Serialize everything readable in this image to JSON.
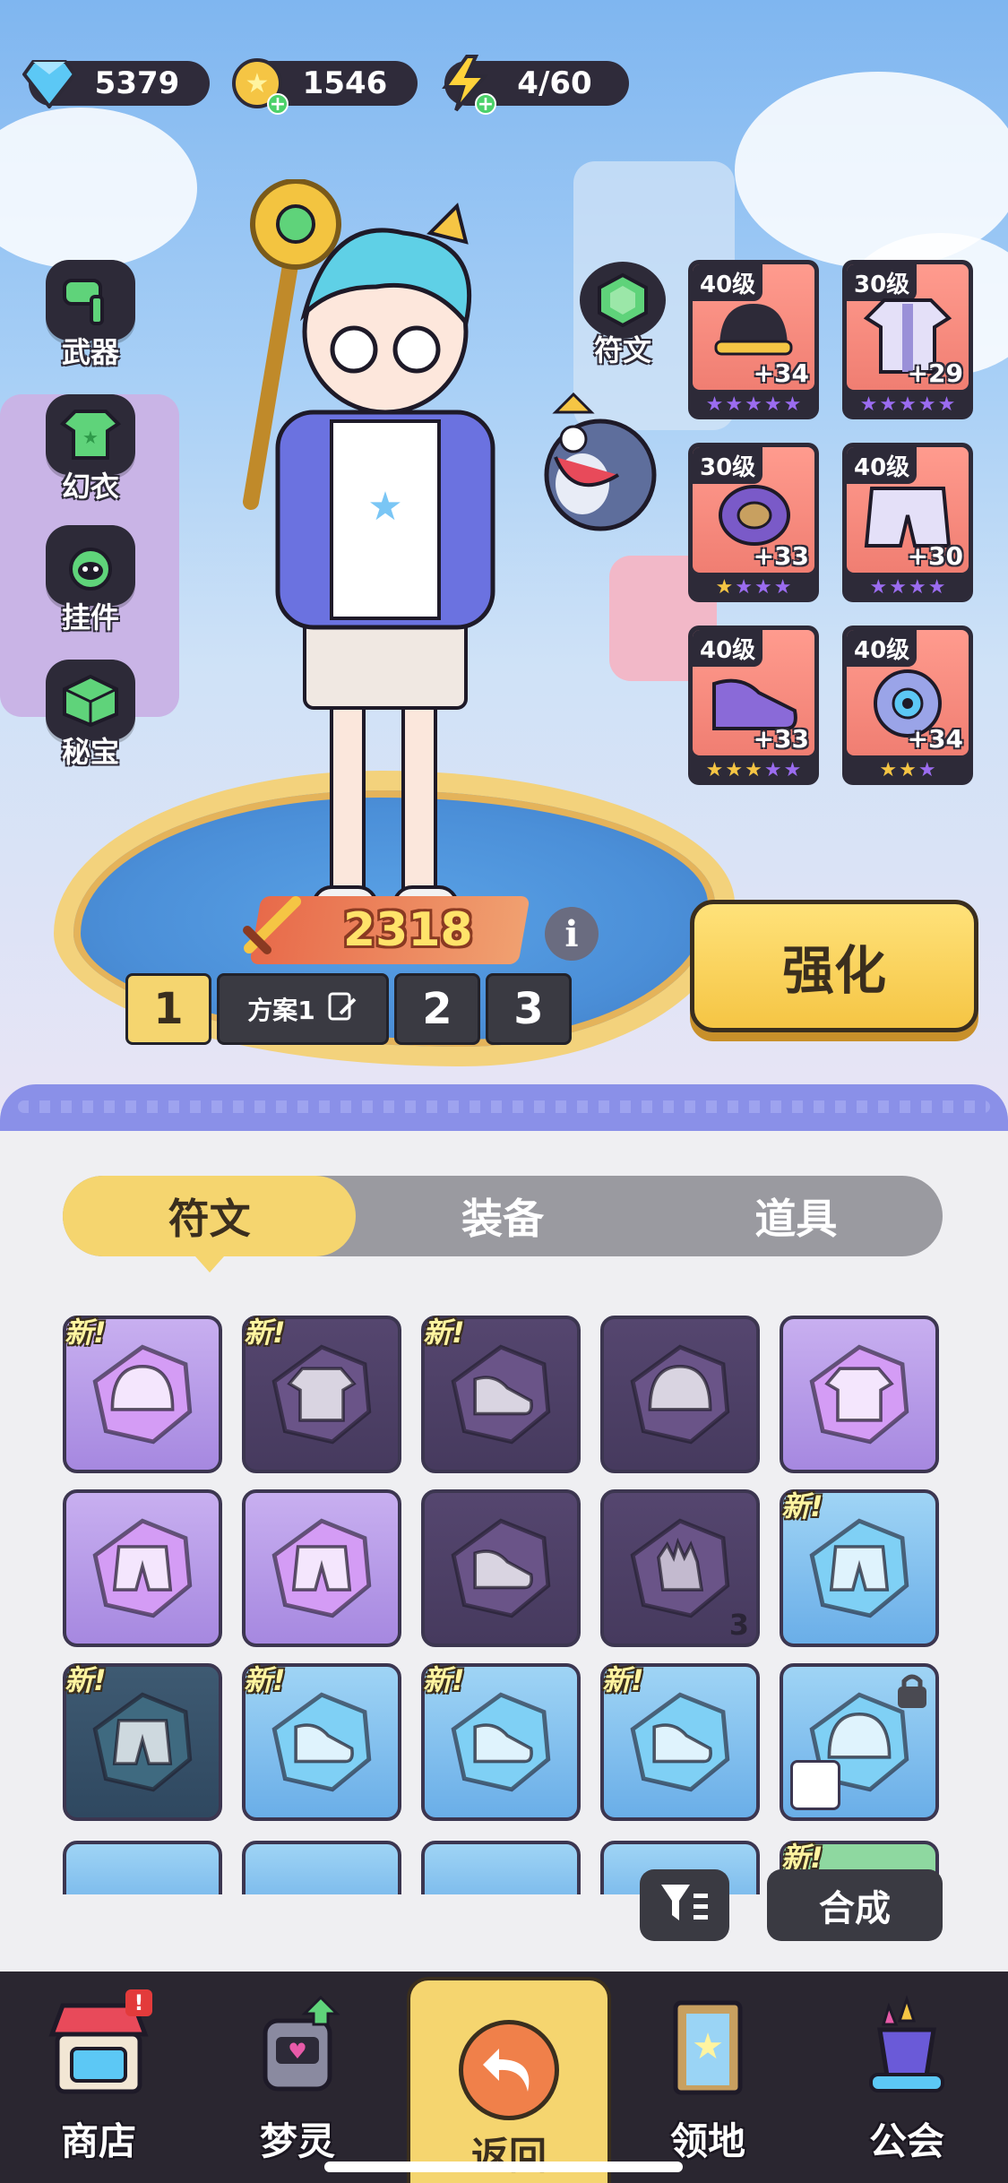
{
  "resources": [
    {
      "id": "gems",
      "icon": "diamond-icon",
      "value": "5379",
      "has_plus": false
    },
    {
      "id": "coins",
      "icon": "coin-icon",
      "value": "1546",
      "has_plus": true
    },
    {
      "id": "energy",
      "icon": "lightning-icon",
      "value": "4/60",
      "has_plus": true
    }
  ],
  "side_menu": [
    {
      "id": "weapon",
      "label": "武器",
      "icon": "hammer-icon"
    },
    {
      "id": "outfit",
      "label": "幻衣",
      "icon": "shirt-icon"
    },
    {
      "id": "pendant",
      "label": "挂件",
      "icon": "pendant-icon"
    },
    {
      "id": "treasure",
      "label": "秘宝",
      "icon": "cube-icon"
    }
  ],
  "rune_button": {
    "label": "符文",
    "icon": "rune-gem-icon"
  },
  "equipment": [
    {
      "level": "40级",
      "bonus": "+34",
      "icon": "helmet-icon",
      "stars": [
        "purple",
        "purple",
        "purple",
        "purple",
        "purple"
      ]
    },
    {
      "level": "30级",
      "bonus": "+29",
      "icon": "jacket-icon",
      "stars": [
        "purple",
        "purple",
        "purple",
        "purple",
        "purple"
      ]
    },
    {
      "level": "30级",
      "bonus": "+33",
      "icon": "wristband-icon",
      "stars": [
        "gold",
        "purple",
        "purple",
        "purple"
      ]
    },
    {
      "level": "40级",
      "bonus": "+30",
      "icon": "shorts-icon",
      "stars": [
        "purple",
        "purple",
        "purple",
        "purple"
      ]
    },
    {
      "level": "40级",
      "bonus": "+33",
      "icon": "shoe-icon",
      "stars": [
        "gold",
        "gold",
        "gold",
        "purple",
        "purple"
      ]
    },
    {
      "level": "40级",
      "bonus": "+34",
      "icon": "orb-icon",
      "stars": [
        "gold",
        "gold",
        "purple"
      ]
    }
  ],
  "power": {
    "value": "2318",
    "icon": "sword-icon"
  },
  "info_button": {
    "label": "i"
  },
  "presets": {
    "active": "1",
    "active_name": "方案1",
    "others": [
      "2",
      "3"
    ]
  },
  "strengthen_button": {
    "label": "强化"
  },
  "tabs": [
    {
      "label": "符文",
      "active": true
    },
    {
      "label": "装备",
      "active": false
    },
    {
      "label": "道具",
      "active": false
    }
  ],
  "inventory": [
    {
      "tier": "purple",
      "new": true,
      "icon": "helmet-rune-icon",
      "count": ""
    },
    {
      "tier": "dark",
      "new": true,
      "icon": "jacket-rune-icon",
      "count": ""
    },
    {
      "tier": "dark",
      "new": true,
      "icon": "shoe-rune-icon",
      "count": ""
    },
    {
      "tier": "dark",
      "new": false,
      "icon": "helmet-rune-icon",
      "count": ""
    },
    {
      "tier": "purple",
      "new": false,
      "icon": "jacket-rune-icon",
      "count": ""
    },
    {
      "tier": "purple",
      "new": false,
      "icon": "shorts-rune-icon",
      "count": ""
    },
    {
      "tier": "purple",
      "new": false,
      "icon": "shorts-rune-icon",
      "count": ""
    },
    {
      "tier": "dark",
      "new": false,
      "icon": "shoe-rune-icon",
      "count": ""
    },
    {
      "tier": "dark",
      "new": false,
      "icon": "glove-rune-icon",
      "count": "3"
    },
    {
      "tier": "blue",
      "new": true,
      "icon": "shorts-rune-icon",
      "count": ""
    },
    {
      "tier": "darkblue",
      "new": true,
      "icon": "shorts-rune-icon",
      "count": ""
    },
    {
      "tier": "blue",
      "new": true,
      "icon": "shoe-rune-icon",
      "count": ""
    },
    {
      "tier": "blue",
      "new": true,
      "icon": "shoe-rune-icon",
      "count": ""
    },
    {
      "tier": "blue",
      "new": true,
      "icon": "shoe-rune-icon",
      "count": ""
    },
    {
      "tier": "blue",
      "new": false,
      "icon": "helmet-rune-icon",
      "count": "",
      "locked": true,
      "equipped_by": true
    }
  ],
  "inventory_partial_row": [
    {
      "tier": "blue",
      "new": false,
      "locked": true
    },
    {
      "tier": "blue",
      "new": false,
      "locked": false
    },
    {
      "tier": "blue",
      "new": false,
      "locked": true
    },
    {
      "tier": "blue",
      "new": false,
      "locked": false
    },
    {
      "tier": "green",
      "new": true,
      "locked": false
    }
  ],
  "new_tag": "新!",
  "filter_button": {
    "icon": "filter-icon"
  },
  "compose_button": {
    "label": "合成"
  },
  "bottom_nav": [
    {
      "id": "shop",
      "label": "商店",
      "icon": "shop-icon",
      "badge": "!"
    },
    {
      "id": "dream",
      "label": "梦灵",
      "icon": "robot-icon",
      "badge": ""
    },
    {
      "id": "back",
      "label": "返回",
      "icon": "back-arrow-icon",
      "active": true
    },
    {
      "id": "territory",
      "label": "领地",
      "icon": "door-icon",
      "badge": ""
    },
    {
      "id": "guild",
      "label": "公会",
      "icon": "guild-hat-icon",
      "badge": ""
    }
  ],
  "colors": {
    "accent_yellow": "#f5d56f",
    "dark": "#2d2a38",
    "star_purple": "#9b6cf0",
    "star_gold": "#f5c544"
  }
}
